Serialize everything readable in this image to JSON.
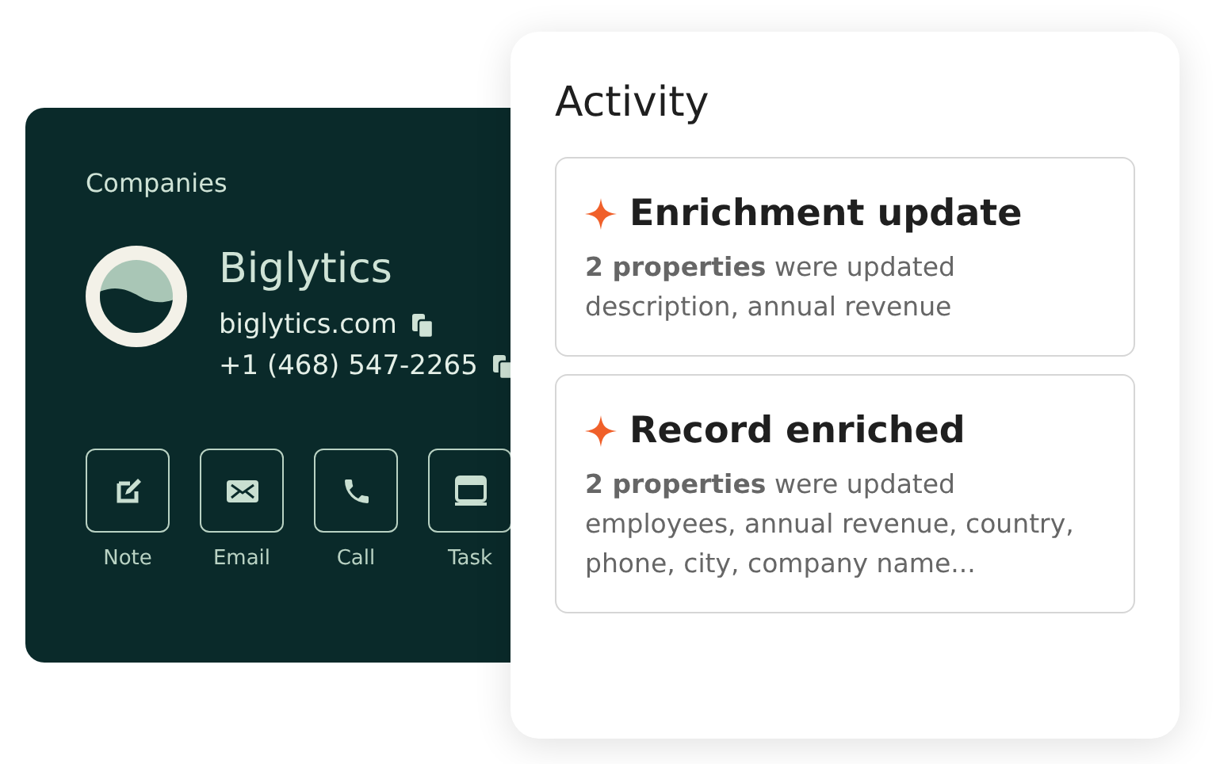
{
  "company_card": {
    "section": "Companies",
    "name": "Biglytics",
    "website": "biglytics.com",
    "phone": "+1 (468) 547-2265",
    "actions": [
      {
        "kind": "note",
        "label": "Note"
      },
      {
        "kind": "email",
        "label": "Email"
      },
      {
        "kind": "call",
        "label": "Call"
      },
      {
        "kind": "task",
        "label": "Task"
      }
    ]
  },
  "activity": {
    "title": "Activity",
    "items": [
      {
        "title": "Enrichment update",
        "summary": "**2 properties** were updated",
        "details": "description, annual revenue"
      },
      {
        "title": "Record enriched",
        "summary": "**2 properties** were updated",
        "details": "employees, annual revenue, country, phone, city, company name..."
      }
    ]
  }
}
